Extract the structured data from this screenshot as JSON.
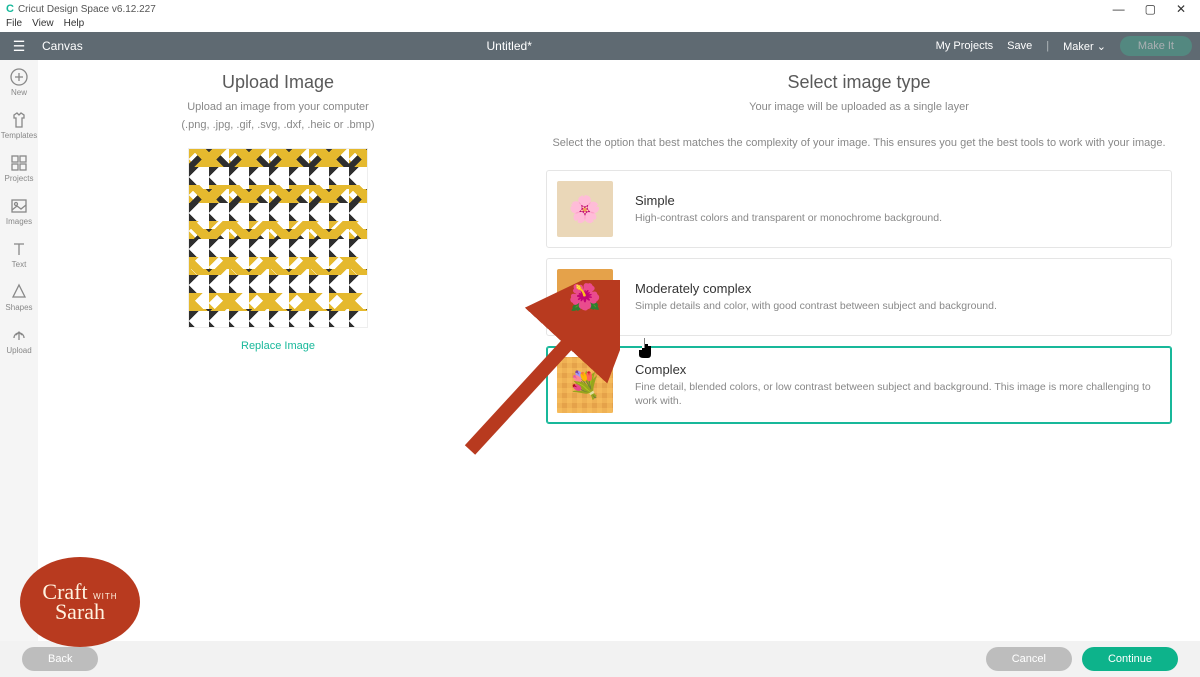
{
  "window": {
    "app_name": "Cricut Design Space v6.12.227",
    "menus": [
      "File",
      "View",
      "Help"
    ]
  },
  "header": {
    "canvas": "Canvas",
    "doc_title": "Untitled*",
    "my_projects": "My Projects",
    "save": "Save",
    "device": "Maker",
    "make_it": "Make It"
  },
  "sidebar": {
    "items": [
      {
        "label": "New"
      },
      {
        "label": "Templates"
      },
      {
        "label": "Projects"
      },
      {
        "label": "Images"
      },
      {
        "label": "Text"
      },
      {
        "label": "Shapes"
      },
      {
        "label": "Upload"
      }
    ]
  },
  "left": {
    "title": "Upload Image",
    "sub1": "Upload an image from your computer",
    "sub2": "(.png, .jpg, .gif, .svg, .dxf, .heic or .bmp)",
    "replace": "Replace Image"
  },
  "right": {
    "title": "Select image type",
    "sub1": "Your image will be uploaded as a single layer",
    "sub2": "Select the option that best matches the complexity of your image. This ensures you get the best tools to work with your image.",
    "options": [
      {
        "title": "Simple",
        "desc": "High-contrast colors and transparent or monochrome background."
      },
      {
        "title": "Moderately complex",
        "desc": "Simple details and color, with good contrast between subject and background."
      },
      {
        "title": "Complex",
        "desc": "Fine detail, blended colors, or low contrast between subject and background. This image is more challenging to work with."
      }
    ]
  },
  "footer": {
    "back": "Back",
    "cancel": "Cancel",
    "continue": "Continue"
  },
  "badge": {
    "line1": "Craft",
    "with": "WITH",
    "line2": "Sarah"
  }
}
